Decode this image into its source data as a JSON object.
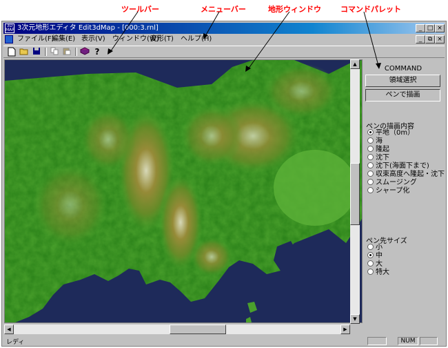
{
  "annotations": {
    "toolbar": "ツールバー",
    "menubar": "メニューバー",
    "terrain_window": "地形ウィンドウ",
    "command_palette": "コマンドパレット"
  },
  "window": {
    "title": "3次元地形エディタ Edit3dMap - [000:3.rnl]",
    "app_icon_label": "3D MAP",
    "controls": {
      "minimize": "_",
      "maximize": "□",
      "close": "×",
      "restore": "⧉"
    }
  },
  "menu": {
    "items": [
      "ファイル(F)",
      "編集(E)",
      "表示(V)",
      "ウィンドウ(W)",
      "変形(T)",
      "ヘルプ(H)"
    ]
  },
  "toolbar": {
    "icons": [
      "new-file-icon",
      "open-folder-icon",
      "save-disk-icon",
      "copy-icon",
      "paste-icon",
      "book-icon",
      "help-icon"
    ]
  },
  "panel": {
    "title": "COMMAND",
    "btn_region": "領域選択",
    "btn_pen": "ペンで描画",
    "pen_content_label": "ペンの描画内容",
    "pen_options": [
      "平地（0m）",
      "海",
      "隆起",
      "沈下",
      "沈下(海面下まで)",
      "収束高度へ隆起・沈下",
      "スムージング",
      "シャープ化"
    ],
    "pen_selected": 0,
    "pen_size_label": "ペン先サイズ",
    "size_options": [
      "小",
      "中",
      "大",
      "特大"
    ],
    "size_selected": 1
  },
  "status": {
    "text": "レディ",
    "num": "NUM"
  },
  "colors": {
    "annotation": "#ff0000",
    "sea": "#1e2a5a",
    "land_low": "#4aa02c",
    "land_mid": "#8a8a2a",
    "land_high": "#e0d8c0",
    "titlebar": "#000080"
  }
}
